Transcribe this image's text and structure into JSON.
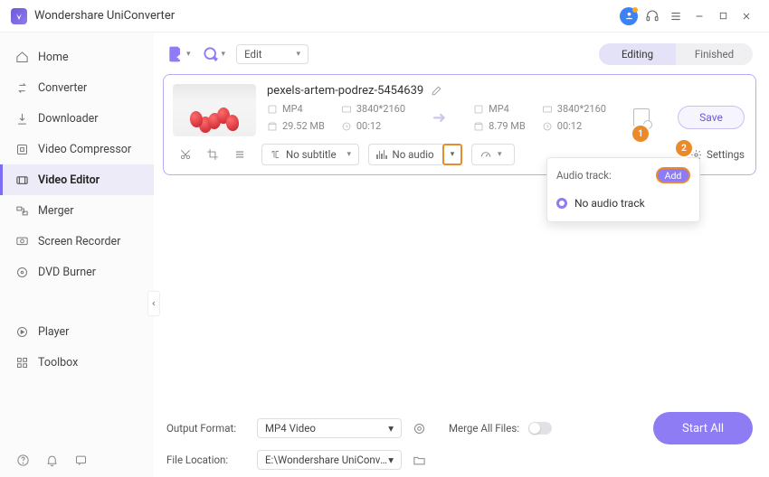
{
  "app": {
    "title": "Wondershare UniConverter"
  },
  "titlebar_icons": [
    "user",
    "headset",
    "menu",
    "minimize",
    "maximize",
    "close"
  ],
  "sidebar": {
    "items": [
      {
        "label": "Home",
        "icon": "home"
      },
      {
        "label": "Converter",
        "icon": "converter"
      },
      {
        "label": "Downloader",
        "icon": "download"
      },
      {
        "label": "Video Compressor",
        "icon": "compress"
      },
      {
        "label": "Video Editor",
        "icon": "editor",
        "active": true
      },
      {
        "label": "Merger",
        "icon": "merge"
      },
      {
        "label": "Screen Recorder",
        "icon": "record"
      },
      {
        "label": "DVD Burner",
        "icon": "disc"
      },
      {
        "label": "Player",
        "icon": "play"
      },
      {
        "label": "Toolbox",
        "icon": "grid"
      }
    ]
  },
  "toolbar": {
    "edit_label": "Edit",
    "tab_editing": "Editing",
    "tab_finished": "Finished"
  },
  "file": {
    "name": "pexels-artem-podrez-5454639",
    "in": {
      "format": "MP4",
      "resolution": "3840*2160",
      "size": "29.52 MB",
      "duration": "00:12"
    },
    "out": {
      "format": "MP4",
      "resolution": "3840*2160",
      "size": "8.79 MB",
      "duration": "00:12"
    },
    "save_label": "Save",
    "subtitle_label": "No subtitle",
    "audio_label": "No audio",
    "speed_label": "",
    "settings_label": "Settings"
  },
  "badges": {
    "one": "1",
    "two": "2"
  },
  "audio_dropdown": {
    "header": "Audio track:",
    "add_label": "Add",
    "option_none": "No audio track"
  },
  "footer": {
    "format_label": "Output Format:",
    "format_value": "MP4 Video",
    "location_label": "File Location:",
    "location_value": "E:\\Wondershare UniConverter",
    "merge_label": "Merge All Files:",
    "start_label": "Start All"
  }
}
